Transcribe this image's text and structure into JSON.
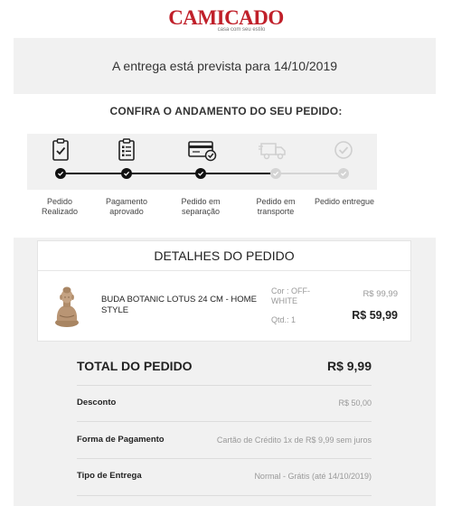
{
  "header": {
    "brand": "CAMICADO",
    "tagline": "casa com seu estilo"
  },
  "delivery_banner": "A entrega está prevista para 14/10/2019",
  "tracking": {
    "title": "CONFIRA O ANDAMENTO DO SEU PEDIDO:",
    "steps": [
      {
        "label": "Pedido Realizado",
        "icon": "clipboard-check-icon",
        "done": true
      },
      {
        "label": "Pagamento aprovado",
        "icon": "clipboard-list-icon",
        "done": true
      },
      {
        "label": "Pedido em separação",
        "icon": "credit-card-check-icon",
        "done": true
      },
      {
        "label": "Pedido em transporte",
        "icon": "delivery-truck-icon",
        "done": false
      },
      {
        "label": "Pedido entregue",
        "icon": "circle-check-icon",
        "done": false
      }
    ]
  },
  "order": {
    "title": "DETALHES DO PEDIDO",
    "item": {
      "name": "BUDA BOTANIC LOTUS 24 CM - HOME STYLE",
      "color": "Cor : OFF-WHITE",
      "quantity": "Qtd.: 1",
      "price_old": "R$ 99,99",
      "price_new": "R$ 59,99",
      "image": "buddha-statue-image"
    }
  },
  "summary": {
    "total_label": "TOTAL DO PEDIDO",
    "total_value": "R$ 9,99",
    "rows": [
      {
        "label": "Desconto",
        "value": "R$ 50,00"
      },
      {
        "label": "Forma de Pagamento",
        "value": "Cartão de Crédito 1x de R$ 9,99 sem juros"
      },
      {
        "label": "Tipo de Entrega",
        "value": "Normal - Grátis (até 14/10/2019)"
      }
    ]
  },
  "colors": {
    "brand": "#c0202a",
    "step_done": "#111111",
    "step_todo": "#d4d4d4",
    "panel_bg": "#f1f1f1"
  }
}
